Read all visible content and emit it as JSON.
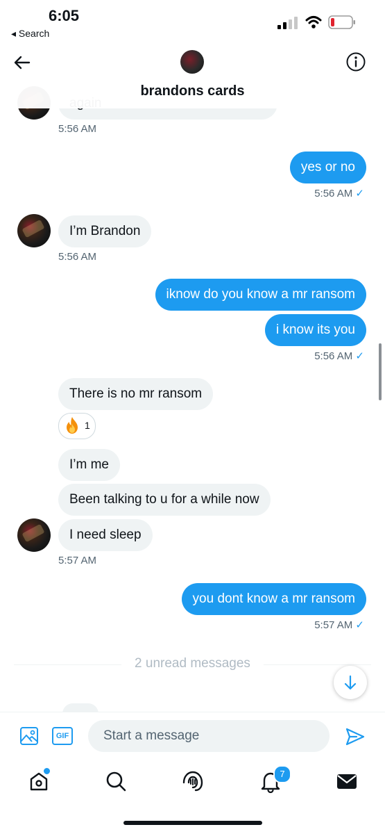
{
  "status_bar": {
    "time": "6:05",
    "back_app": "◂ Search"
  },
  "header": {
    "title": "brandons cards"
  },
  "messages": {
    "m1": {
      "partial": "again",
      "time": "5:56 AM"
    },
    "m2": {
      "text": "yes or no",
      "time": "5:56 AM"
    },
    "m3": {
      "text": "I’m Brandon",
      "time": "5:56 AM"
    },
    "m4": {
      "text": "iknow do you know a mr ransom"
    },
    "m5": {
      "text": "i know its you",
      "time": "5:56 AM"
    },
    "m6": {
      "text": "There is no mr ransom",
      "reaction_count": "1"
    },
    "m7": {
      "text": "I’m me"
    },
    "m8": {
      "text": "Been talking to u for a while now"
    },
    "m9": {
      "text": "I need sleep",
      "time": "5:57 AM"
    },
    "m10": {
      "text": "you dont know a mr ransom",
      "time": "5:57 AM"
    }
  },
  "read_mark": "✓",
  "unread": {
    "label": "2 unread messages"
  },
  "composer": {
    "gif_label": "GIF",
    "placeholder": "Start a message"
  },
  "tabbar": {
    "notifications_count": "7"
  },
  "colors": {
    "accent": "#1d9bf0",
    "incoming_bubble": "#eff3f4",
    "secondary_text": "#536471"
  },
  "icons": [
    "back-arrow-icon",
    "info-icon",
    "media-icon",
    "send-icon",
    "home-icon",
    "search-icon",
    "spaces-icon",
    "bell-icon",
    "mail-icon",
    "arrow-down-icon",
    "fire-emoji-icon"
  ]
}
